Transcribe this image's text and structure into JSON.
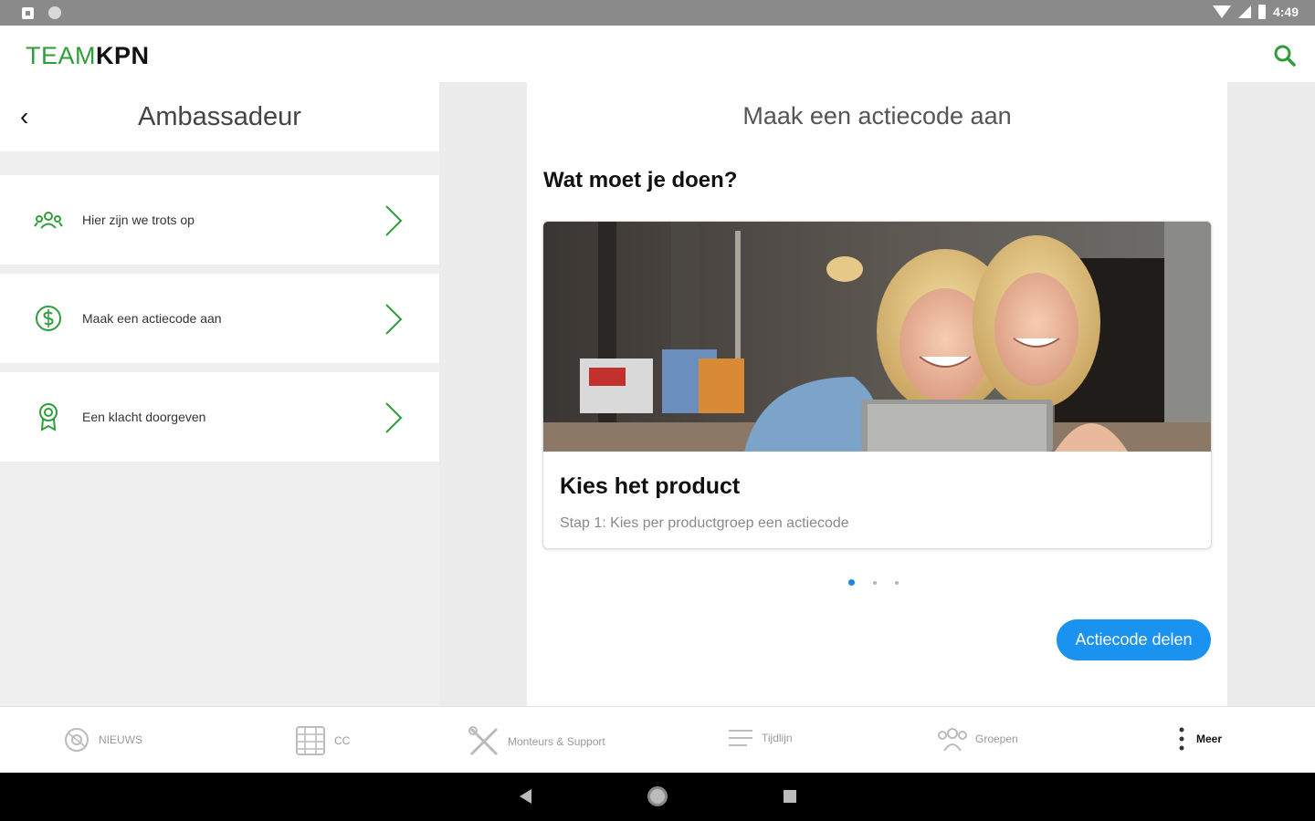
{
  "status_bar": {
    "time": "4:49"
  },
  "app": {
    "logo_part1": "TEAM",
    "logo_part2": "KPN"
  },
  "left_panel": {
    "title": "Ambassadeur",
    "items": [
      {
        "label": "Hier zijn we trots op",
        "icon": "team-icon"
      },
      {
        "label": "Maak een actiecode aan",
        "icon": "coin-icon"
      },
      {
        "label": "Een klacht doorgeven",
        "icon": "award-icon"
      }
    ]
  },
  "right_panel": {
    "title": "Maak een actiecode aan",
    "section_heading": "Wat moet je doen?",
    "card": {
      "title": "Kies het product",
      "subtitle": "Stap 1: Kies per productgroep een actiecode",
      "image": "two-girls-with-tablet-photo"
    },
    "pager": {
      "count": 3,
      "active": 1
    },
    "share_button": "Actiecode delen"
  },
  "bottom_nav": {
    "items": [
      {
        "label": "NIEUWS",
        "icon": "news-icon"
      },
      {
        "label": "CC",
        "icon": "cc-icon"
      },
      {
        "label": "Monteurs & Support",
        "icon": "tools-icon"
      },
      {
        "label": "Tijdlijn",
        "icon": "timeline-icon"
      },
      {
        "label": "Groepen",
        "icon": "groups-icon"
      },
      {
        "label": "Meer",
        "icon": "more-icon"
      }
    ],
    "active": "Meer"
  },
  "colors": {
    "brand_green": "#2e9e3a",
    "accent_blue": "#1a92f0"
  }
}
